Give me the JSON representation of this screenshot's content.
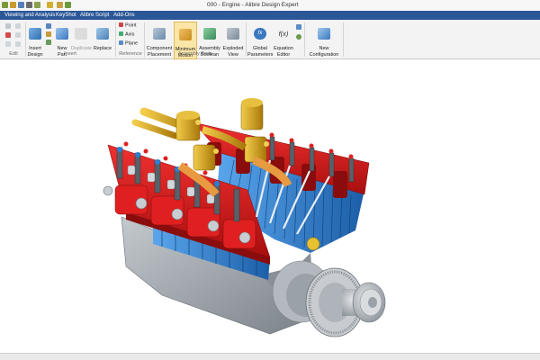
{
  "window": {
    "title": "000 - Engine - Alibre Design Expert"
  },
  "menu": {
    "items": [
      "Viewing and Analysis",
      "KeyShot",
      "Alibre Script",
      "Add-Ons"
    ]
  },
  "ribbon": {
    "edit_group": {
      "label": "Edit"
    },
    "insert_group": {
      "label": "Insert",
      "insert_design": "Insert\nDesign",
      "new_part": "New\nPart",
      "duplicate": "Duplicate",
      "replace": "Replace"
    },
    "reference_group": {
      "label": "Reference",
      "point": "Point",
      "axis": "Axis",
      "plane": "Plane"
    },
    "assembly_tools_group": {
      "label": "Assembly Tools",
      "component_placement": "Component\nPlacement",
      "minimum_motion": "Minimum\nMotion",
      "assembly_boolean": "Assembly\nBoolean",
      "exploded_view": "Exploded\nView"
    },
    "parameters_group": {
      "global_parameters": "Global\nParameters",
      "equation_editor": "Equation\nEditor",
      "global_parameters_glyph": "fx",
      "equation_editor_glyph": "f(x)"
    },
    "config_group": {
      "new_configuration": "New\nConfiguration"
    }
  },
  "model": {
    "name": "Engine",
    "colors": {
      "cylinder_head": "#d81818",
      "cylinder_fins": "#2a7fd4",
      "brass_fittings": "#d4a010",
      "block": "#9ea4ab",
      "accent_blue": "#2b5797"
    }
  },
  "icons": {
    "title_quick_access": [
      "new-icon",
      "open-icon",
      "save-icon",
      "print-icon",
      "undo-icon",
      "redo-icon",
      "measure-icon"
    ]
  }
}
